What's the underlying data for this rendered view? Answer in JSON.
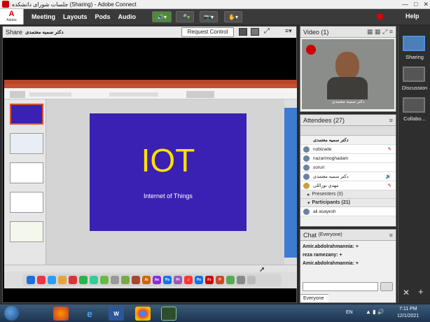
{
  "window": {
    "title": "جلسات شورای دانشکده (Sharing) - Adobe Connect",
    "min": "—",
    "max": "□",
    "close": "✕"
  },
  "adobe": {
    "brand": "Adobe"
  },
  "menu": {
    "items": [
      "Meeting",
      "Layouts",
      "Pods",
      "Audio"
    ],
    "help": "Help"
  },
  "share_pod": {
    "title": "Share",
    "presenter": "دکتر سمیه معتمدی",
    "request_control": "Request Control"
  },
  "slide": {
    "title": "IOT",
    "subtitle": "Internet of Things"
  },
  "video_pod": {
    "title": "Video",
    "count": "(1)",
    "camera_name": "دکتر سمیه معتمدی"
  },
  "attendees_pod": {
    "title": "Attendees",
    "count": "(27)",
    "host_header": "دکتر سمیه معتمدی",
    "hosts": [
      {
        "name": "nobizade"
      },
      {
        "name": "nazarimoghadam"
      },
      {
        "name": "soruri"
      },
      {
        "name": "دکتر سمیه معتمدی"
      },
      {
        "name": "مهدی نوراللی"
      }
    ],
    "presenters_label": "Presenters (0)",
    "participants_label": "Participants (21)",
    "participants": [
      {
        "name": "ali asayesh"
      }
    ]
  },
  "chat_pod": {
    "title": "Chat",
    "scope": "(Everyone)",
    "messages": [
      "Amir.abdolrahmannia: +",
      "reza ramezany: +",
      "Amir.abdolrahmannia: +"
    ],
    "tab": "Everyone"
  },
  "layouts": [
    {
      "label": "Sharing"
    },
    {
      "label": "Discussion"
    },
    {
      "label": "Collabo..."
    }
  ],
  "taskbar": {
    "lang": "EN",
    "time": "7:11 PM",
    "date": "12/1/2021",
    "apps": [
      "firefox",
      "ie",
      "word",
      "chrome",
      "adobe-connect"
    ]
  },
  "colors": {
    "slide_bg": "#3b21b3",
    "slide_title": "#ffe000",
    "menubar": "#3a3a3a",
    "record": "#e00000"
  }
}
